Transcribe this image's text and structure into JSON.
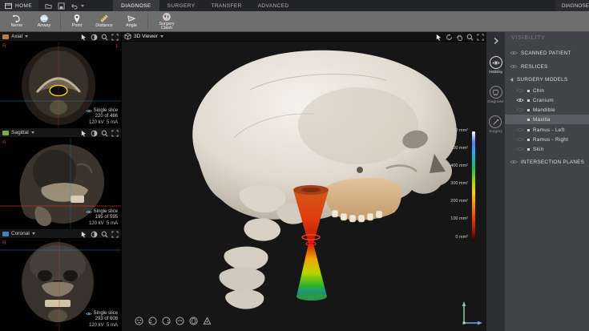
{
  "menubar": {
    "home_label": "HOME",
    "tabs": [
      {
        "label": "DIAGNOSE"
      },
      {
        "label": "SURGERY"
      },
      {
        "label": "TRANSFER"
      },
      {
        "label": "ADVANCED"
      }
    ],
    "active_tab": "DIAGNOSE",
    "right_label": "DIAGNOSE"
  },
  "toolbar": {
    "buttons": [
      {
        "label": "Nerve"
      },
      {
        "label": "Airway"
      },
      {
        "label": "Point"
      },
      {
        "label": "Distance"
      },
      {
        "label": "Angle"
      },
      {
        "label": "Surgery Clash"
      }
    ]
  },
  "views": {
    "axial": {
      "title": "Axial",
      "marker_left": "R",
      "marker_right": "L",
      "info_mode": "Single slice",
      "info_slice": "220 of 466",
      "info_exposure": "120 kV  5 mA"
    },
    "sagittal": {
      "title": "Sagittal",
      "marker_left": "A",
      "info_mode": "Single slice",
      "info_slice": "195 of 595",
      "info_exposure": "120 kV  5 mA"
    },
    "coronal": {
      "title": "Coronal",
      "marker_left": "R",
      "info_mode": "Single slice",
      "info_slice": "293 of 608",
      "info_exposure": "120 kV  5 mA"
    },
    "viewer3d": {
      "title": "3D Viewer"
    }
  },
  "colorbar": {
    "unit": "mm²",
    "labels": [
      "600 mm²",
      "500 mm²",
      "400 mm²",
      "300 mm²",
      "200 mm²",
      "100 mm²",
      "0 mm²"
    ]
  },
  "rail": {
    "items": [
      {
        "label": "Visibility",
        "active": true
      },
      {
        "label": "Diagnose",
        "active": false
      },
      {
        "label": "Surgery",
        "active": false
      }
    ]
  },
  "sidebar": {
    "title": "VISIBILITY",
    "scanned_patient": "SCANNED PATIENT",
    "reslices": "RESLICES",
    "surgery_models": "SURGERY MODELS",
    "intersection_planes": "INTERSECTION PLANES",
    "models": [
      {
        "label": "Chin",
        "eye_visible": false
      },
      {
        "label": "Cranium",
        "eye_visible": true
      },
      {
        "label": "Mandible",
        "eye_visible": false
      },
      {
        "label": "Maxilla",
        "eye_visible": false,
        "selected": true
      },
      {
        "label": "Ramus - Left",
        "eye_visible": false
      },
      {
        "label": "Ramus - Right",
        "eye_visible": false
      },
      {
        "label": "Skin",
        "eye_visible": false
      }
    ],
    "selected_model": "Maxilla"
  },
  "colors": {
    "highlight_yellow": "#ffe400",
    "axial_plane": "#c87a3c",
    "sagittal_plane": "#76b043",
    "coronal_plane": "#3c86c8",
    "selection_bg": "#5a5d62",
    "crosshair_red": "#c23b2e",
    "crosshair_blue": "#2c86b8"
  }
}
